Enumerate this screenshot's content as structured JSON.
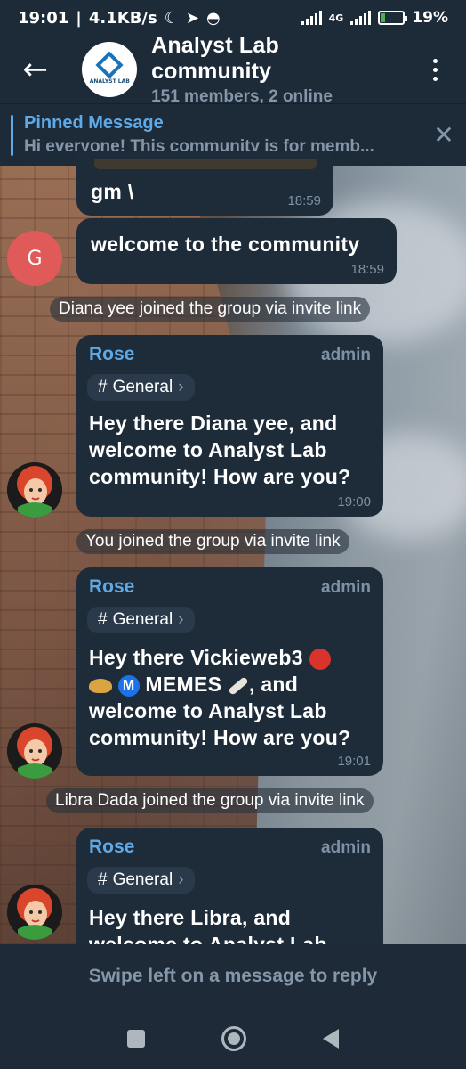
{
  "status": {
    "time": "19:01",
    "speed": "4.1KB/s",
    "network": "4G",
    "battery": "19%",
    "battery_level": 0.19
  },
  "header": {
    "title": "Analyst Lab community",
    "subtitle": "151 members, 2 online",
    "avatar_text": "ANALYST LAB"
  },
  "pinned": {
    "title": "Pinned Message",
    "text": "Hi everyone! This community is for memb..."
  },
  "messages": [
    {
      "text": "gm \\",
      "time": "18:59"
    },
    {
      "avatar": "G",
      "text": "welcome to the community",
      "time": "18:59"
    },
    {
      "service": "Diana yee joined the group via invite link"
    },
    {
      "sender": "Rose",
      "role": "admin",
      "topic": "General",
      "text": "Hey there Diana yee, and welcome to Analyst Lab community! How are you?",
      "time": "19:00"
    },
    {
      "service": "You joined the group via invite link"
    },
    {
      "sender": "Rose",
      "role": "admin",
      "topic": "General",
      "text_line1": "Hey there Vickieweb3",
      "text_line2": "MEMES",
      "text_line2_end": ", and",
      "text_line3": "welcome to Analyst Lab community! How are you?",
      "time": "19:01"
    },
    {
      "service": "Libra Dada joined the group via invite link"
    },
    {
      "sender": "Rose",
      "role": "admin",
      "topic": "General",
      "text_line1": "Hey there Libra, and",
      "text_line2": "welcome to Analyst Lab"
    }
  ],
  "input": {
    "placeholder": "Swipe left on a message to reply"
  },
  "icons": {
    "back": "arrow-left-icon",
    "menu": "more-vertical-icon",
    "close": "close-icon",
    "topic": "hashtag-icon"
  },
  "colors": {
    "accent": "#5ea9e6",
    "bubble": "#1e2c3a",
    "header": "#1d2a38"
  }
}
